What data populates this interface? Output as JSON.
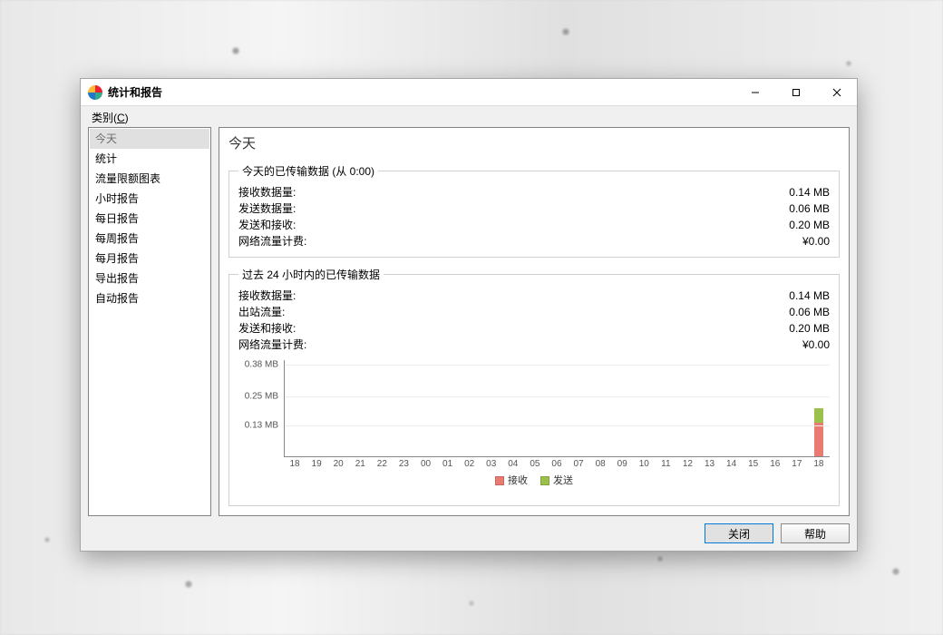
{
  "window": {
    "title": "统计和报告"
  },
  "category_label_prefix": "类别(",
  "category_label_hotkey": "C",
  "category_label_suffix": ")",
  "sidebar": {
    "items": [
      {
        "label": "今天",
        "selected": true
      },
      {
        "label": "统计"
      },
      {
        "label": "流量限额图表"
      },
      {
        "label": "小时报告"
      },
      {
        "label": "每日报告"
      },
      {
        "label": "每周报告"
      },
      {
        "label": "每月报告"
      },
      {
        "label": "导出报告"
      },
      {
        "label": "自动报告"
      }
    ]
  },
  "page": {
    "title": "今天",
    "group_today": {
      "legend": "今天的已传输数据 (从 0:00)",
      "rows": [
        {
          "label": "接收数据量:",
          "value": "0.14 MB"
        },
        {
          "label": "发送数据量:",
          "value": "0.06 MB"
        },
        {
          "label": "发送和接收:",
          "value": "0.20 MB"
        },
        {
          "label": "网络流量计费:",
          "value": "¥0.00"
        }
      ]
    },
    "group_24h": {
      "legend": "过去 24 小时内的已传输数据",
      "rows": [
        {
          "label": "接收数据量:",
          "value": "0.14 MB"
        },
        {
          "label": "出站流量:",
          "value": "0.06 MB"
        },
        {
          "label": "发送和接收:",
          "value": "0.20 MB"
        },
        {
          "label": "网络流量计费:",
          "value": "¥0.00"
        }
      ]
    }
  },
  "legend": {
    "recv": "接收",
    "send": "发送"
  },
  "footer": {
    "close": "关闭",
    "help": "帮助"
  },
  "chart_data": {
    "type": "bar",
    "title": "",
    "xlabel": "",
    "ylabel": "",
    "ylim": [
      0,
      0.4
    ],
    "yticks": [
      "0.13 MB",
      "0.25 MB",
      "0.38 MB"
    ],
    "categories": [
      "18",
      "19",
      "20",
      "21",
      "22",
      "23",
      "00",
      "01",
      "02",
      "03",
      "04",
      "05",
      "06",
      "07",
      "08",
      "09",
      "10",
      "11",
      "12",
      "13",
      "14",
      "15",
      "16",
      "17",
      "18"
    ],
    "series": [
      {
        "name": "接收",
        "color": "#e97b72",
        "values": [
          0,
          0,
          0,
          0,
          0,
          0,
          0,
          0,
          0,
          0,
          0,
          0,
          0,
          0,
          0,
          0,
          0,
          0,
          0,
          0,
          0,
          0,
          0,
          0,
          0.14
        ]
      },
      {
        "name": "发送",
        "color": "#9cc04c",
        "values": [
          0,
          0,
          0,
          0,
          0,
          0,
          0,
          0,
          0,
          0,
          0,
          0,
          0,
          0,
          0,
          0,
          0,
          0,
          0,
          0,
          0,
          0,
          0,
          0,
          0.06
        ]
      }
    ]
  }
}
